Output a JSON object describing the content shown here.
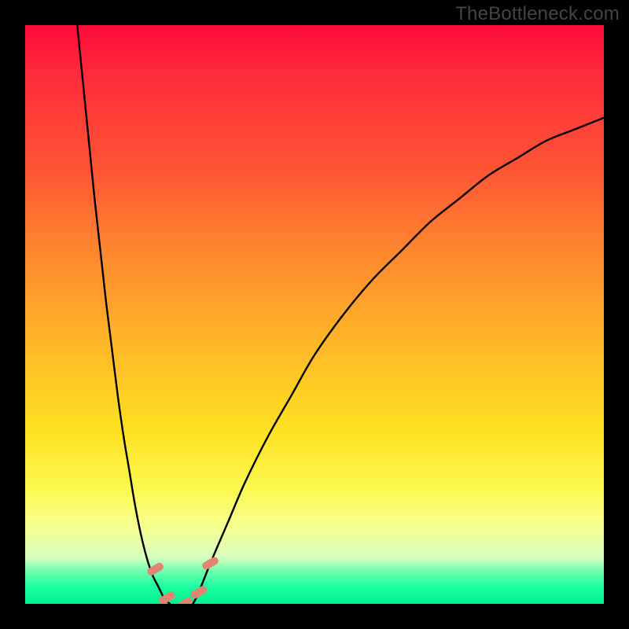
{
  "watermark": "TheBottleneck.com",
  "chart_data": {
    "type": "line",
    "title": "",
    "xlabel": "",
    "ylabel": "",
    "xlim": [
      0,
      100
    ],
    "ylim": [
      0,
      100
    ],
    "grid": false,
    "legend": false,
    "background_gradient": {
      "orientation": "vertical",
      "stops": [
        {
          "pos": 0.0,
          "color": "#ff0a3a"
        },
        {
          "pos": 0.25,
          "color": "#ff5534"
        },
        {
          "pos": 0.55,
          "color": "#ffb728"
        },
        {
          "pos": 0.8,
          "color": "#fcf94f"
        },
        {
          "pos": 0.94,
          "color": "#7dffb0"
        },
        {
          "pos": 1.0,
          "color": "#00f090"
        }
      ]
    },
    "series": [
      {
        "name": "left-curve",
        "stroke": "#000000",
        "x": [
          9,
          10,
          11,
          12,
          13,
          14,
          15,
          16,
          17,
          18,
          19,
          20,
          21,
          22,
          23,
          24,
          25
        ],
        "y": [
          100,
          90,
          80,
          70,
          61,
          52,
          44,
          36,
          29,
          23,
          17,
          12,
          8,
          5,
          3,
          1,
          0
        ]
      },
      {
        "name": "right-curve",
        "stroke": "#000000",
        "x": [
          29,
          30,
          32,
          35,
          38,
          42,
          46,
          50,
          55,
          60,
          65,
          70,
          75,
          80,
          85,
          90,
          95,
          100
        ],
        "y": [
          0,
          2,
          7,
          14,
          21,
          29,
          36,
          43,
          50,
          56,
          61,
          66,
          70,
          74,
          77,
          80,
          82,
          84
        ]
      }
    ],
    "markers": [
      {
        "name": "left-marker-top",
        "x": 22.5,
        "y": 6,
        "color": "#e38372",
        "shape": "lozenge"
      },
      {
        "name": "left-marker-bottom",
        "x": 24.5,
        "y": 1,
        "color": "#e38372",
        "shape": "lozenge"
      },
      {
        "name": "mid-marker",
        "x": 27.5,
        "y": 0,
        "color": "#e38372",
        "shape": "lozenge"
      },
      {
        "name": "right-marker-bottom",
        "x": 30.0,
        "y": 2,
        "color": "#e38372",
        "shape": "lozenge"
      },
      {
        "name": "right-marker-top",
        "x": 32.0,
        "y": 7,
        "color": "#e38372",
        "shape": "lozenge"
      }
    ]
  }
}
